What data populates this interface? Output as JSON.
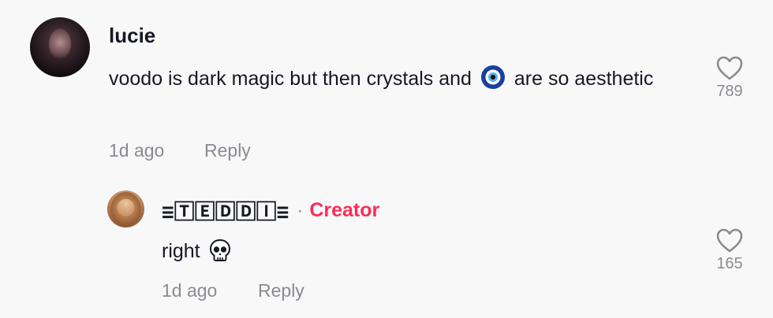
{
  "comment": {
    "username": "lucie",
    "text_before": "voodo is dark magic but then crystals and",
    "emoji": "evil-eye-icon",
    "text_after": "are so aesthetic",
    "time": "1d ago",
    "reply_label": "Reply",
    "like_count": "789",
    "like_icon": "heart-outline-icon"
  },
  "reply": {
    "username": "≡🅃🄴🄳🄳🄸≡",
    "separator": "·",
    "badge": "Creator",
    "text": "right",
    "emoji": "skull-icon",
    "time": "1d ago",
    "reply_label": "Reply",
    "like_count": "165",
    "like_icon": "heart-outline-icon"
  },
  "colors": {
    "background": "#f8f8f8",
    "text": "#161823",
    "muted": "#8a8b91",
    "creator": "#fe2c55"
  }
}
